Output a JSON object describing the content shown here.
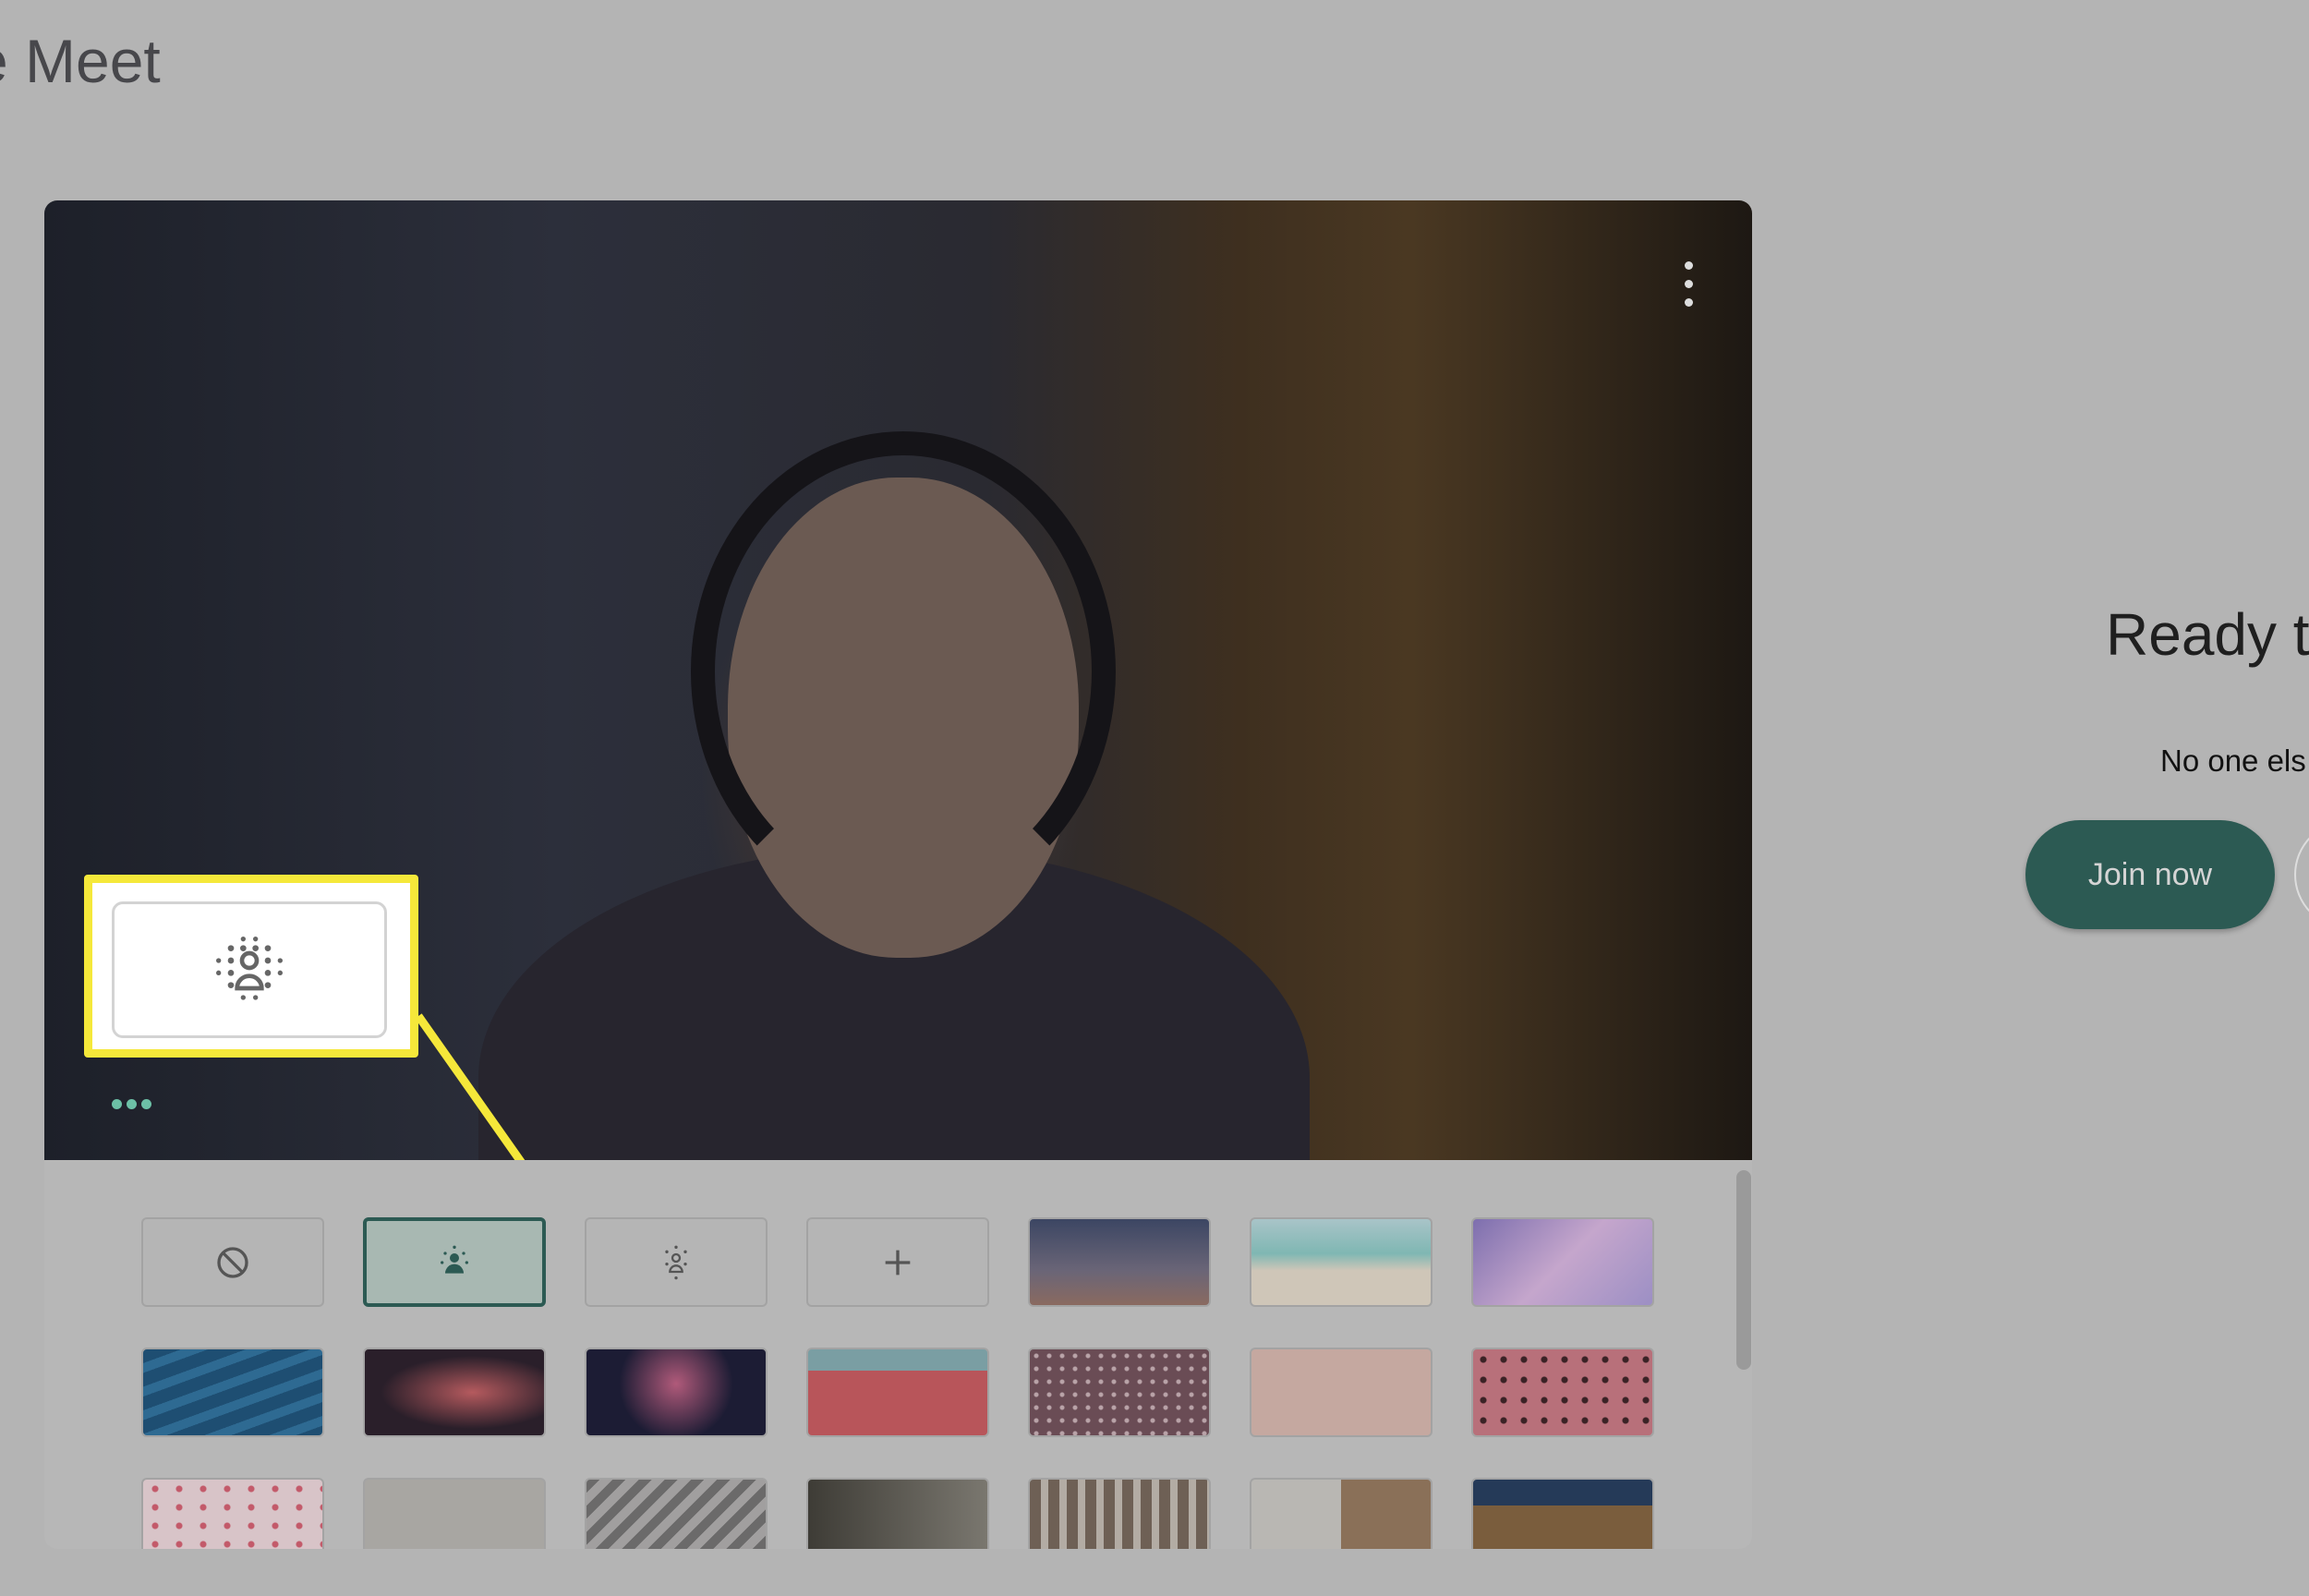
{
  "app": {
    "title": "e Meet"
  },
  "preview": {
    "menu_icon": "more-vert-icon",
    "mic_icon": "mic-icon",
    "camera_icon": "videocam-icon",
    "effects_icon": "background-effects-icon",
    "selected_effect_icon": "background-blur-icon"
  },
  "effects": {
    "tiles": [
      {
        "name": "no-effect",
        "icon": "block-icon"
      },
      {
        "name": "slight-blur",
        "icon": "blur-person-icon",
        "selected": true
      },
      {
        "name": "blur",
        "icon": "blur-icon"
      },
      {
        "name": "add-background",
        "icon": "plus-icon"
      },
      {
        "name": "sunset"
      },
      {
        "name": "beach"
      },
      {
        "name": "clouds"
      },
      {
        "name": "water"
      },
      {
        "name": "galaxy"
      },
      {
        "name": "fireworks"
      },
      {
        "name": "flowers"
      },
      {
        "name": "flower-field"
      },
      {
        "name": "pink-confetti"
      },
      {
        "name": "pink-pattern"
      },
      {
        "name": "confetti"
      },
      {
        "name": "office"
      },
      {
        "name": "bedroom"
      },
      {
        "name": "plants-room"
      },
      {
        "name": "bookshelf"
      },
      {
        "name": "shelves"
      },
      {
        "name": "house"
      }
    ]
  },
  "colors": {
    "accent": "#2c5a53",
    "highlight": "#f5e83a"
  },
  "join": {
    "heading": "Ready t",
    "status": "No one els",
    "join_label": "Join now"
  }
}
